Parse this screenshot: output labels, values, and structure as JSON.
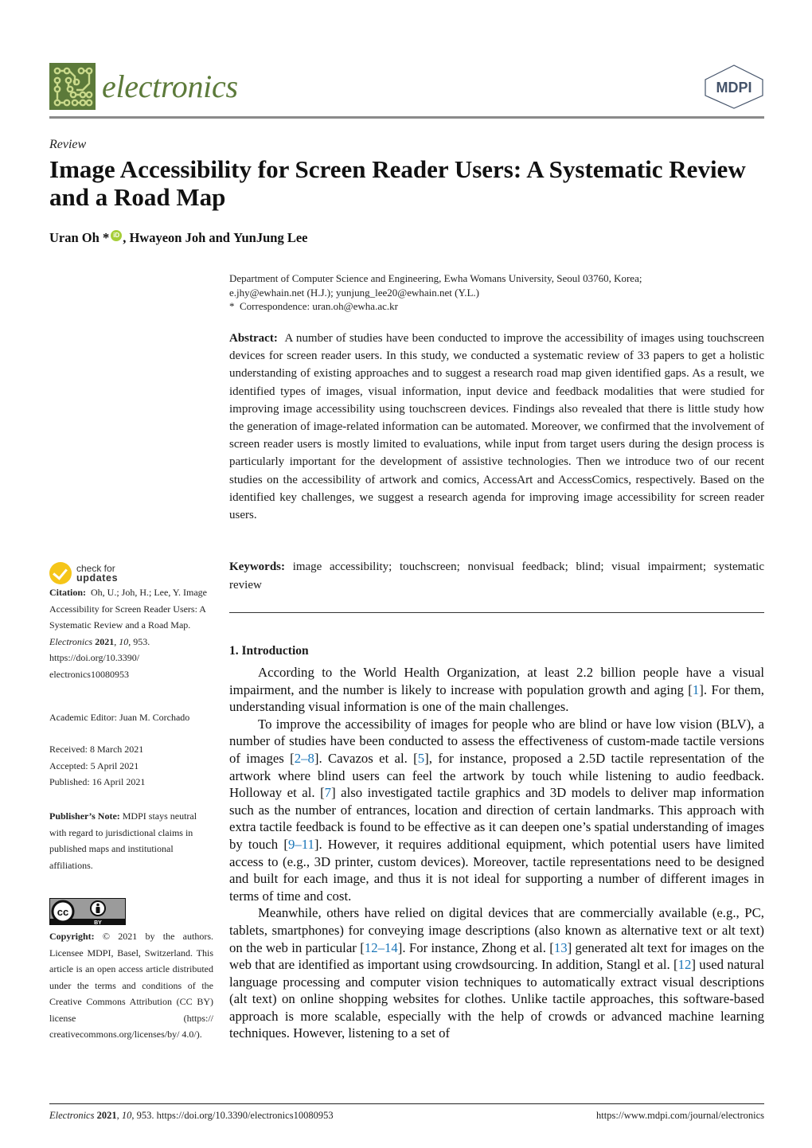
{
  "header": {
    "journal_name": "electronics",
    "journal_logo_icon": "circuit-board-icon",
    "publisher_logo_text": "MDPI",
    "brand_color": "#5c7a3a"
  },
  "article": {
    "type": "Review",
    "title": "Image Accessibility for Screen Reader Users: A Systematic Review and a Road Map",
    "authors": [
      {
        "name": "Uran Oh",
        "mark": "*",
        "orcid": true
      },
      {
        "name": "Hwayeon Joh"
      },
      {
        "name": "YunJung Lee"
      }
    ],
    "author_sep_1": ", ",
    "author_sep_2": " and ",
    "orcid_label": "iD",
    "affiliation_line1": "Department of Computer Science and Engineering, Ewha Womans University, Seoul 03760, Korea;",
    "affiliation_line2": "e.jhy@ewhain.net (H.J.); yunjung_lee20@ewhain.net (Y.L.)",
    "correspondence_mark": "*",
    "correspondence": "Correspondence: uran.oh@ewha.ac.kr",
    "abstract_label": "Abstract:",
    "abstract": "A number of studies have been conducted to improve the accessibility of images using touchscreen devices for screen reader users. In this study, we conducted a systematic review of 33 papers to get a holistic understanding of existing approaches and to suggest a research road map given identified gaps. As a result, we identified types of images, visual information, input device and feedback modalities that were studied for improving image accessibility using touchscreen devices. Findings also revealed that there is little study how the generation of image-related information can be automated. Moreover, we confirmed that the involvement of screen reader users is mostly limited to evaluations, while input from target users during the design process is particularly important for the development of assistive technologies. Then we introduce two of our recent studies on the accessibility of artwork and comics, AccessArt and AccessComics, respectively. Based on the identified key challenges, we suggest a research agenda for improving image accessibility for screen reader users.",
    "keywords_label": "Keywords:",
    "keywords": "image accessibility; touchscreen; nonvisual feedback; blind; visual impairment; systematic review"
  },
  "section": {
    "heading": "1. Introduction",
    "paragraphs": [
      [
        {
          "t": "According to the World Health Organization, at least 2.2 billion people have a visual impairment, and the number is likely to increase with population growth and aging ["
        },
        {
          "ref": "1"
        },
        {
          "t": "]. For them, understanding visual information is one of the main challenges."
        }
      ],
      [
        {
          "t": "To improve the accessibility of images for people who are blind or have low vision (BLV), a number of studies have been conducted to assess the effectiveness of custom-made tactile versions of images ["
        },
        {
          "ref": "2–8"
        },
        {
          "t": "]. Cavazos et al. ["
        },
        {
          "ref": "5"
        },
        {
          "t": "], for instance, proposed a 2.5D tactile representation of the artwork where blind users can feel the artwork by touch while listening to audio feedback. Holloway et al. ["
        },
        {
          "ref": "7"
        },
        {
          "t": "] also investigated tactile graphics and 3D models to deliver map information such as the number of entrances, location and direction of certain landmarks. This approach with extra tactile feedback is found to be effective as it can deepen one’s spatial understanding of images by touch ["
        },
        {
          "ref": "9–11"
        },
        {
          "t": "]. However, it requires additional equipment, which potential users have limited access to (e.g., 3D printer, custom devices). Moreover, tactile representations need to be designed and built for each image, and thus it is not ideal for supporting a number of different images in terms of time and cost."
        }
      ],
      [
        {
          "t": "Meanwhile, others have relied on digital devices that are commercially available (e.g., PC, tablets, smartphones) for conveying image descriptions (also known as alternative text or alt text) on the web in particular ["
        },
        {
          "ref": "12–14"
        },
        {
          "t": "]. For instance, Zhong et al. ["
        },
        {
          "ref": "13"
        },
        {
          "t": "] generated alt text for images on the web that are identified as important using crowdsourcing. In addition, Stangl et al. ["
        },
        {
          "ref": "12"
        },
        {
          "t": "] used natural language processing and computer vision techniques to automatically extract visual descriptions (alt text) on online shopping websites for clothes. Unlike tactile approaches, this software-based approach is more scalable, especially with the help of crowds or advanced machine learning techniques. However, listening to a set of"
        }
      ]
    ],
    "ref_color": "#1a75b8"
  },
  "sidebar": {
    "check_updates_line1": "check for",
    "check_updates_line2": "updates",
    "citation_label": "Citation:",
    "citation_authors": "Oh, U.; Joh, H.; Lee, Y. Image Accessibility for Screen Reader Users: A Systematic Review and a Road Map.",
    "citation_journal": "Electronics",
    "citation_year": "2021",
    "citation_volume": "10",
    "citation_pages": ", 953.",
    "citation_doi": "https://doi.org/10.3390/ electronics10080953",
    "academic_editor": "Academic Editor: Juan M. Corchado",
    "received": "Received: 8 March 2021",
    "accepted": "Accepted: 5 April 2021",
    "published": "Published: 16 April 2021",
    "publisher_note_label": "Publisher’s Note:",
    "publisher_note": "MDPI stays neutral with regard to jurisdictional claims in published maps and institutional affiliations.",
    "cc_label": "cc",
    "cc_by_label": "BY",
    "copyright_label": "Copyright:",
    "copyright": "© 2021 by the authors. Licensee MDPI, Basel, Switzerland. This article is an open access article distributed under the terms and conditions of the Creative Commons Attribution (CC BY) license (https:// creativecommons.org/licenses/by/ 4.0/)."
  },
  "footer": {
    "journal": "Electronics",
    "year": "2021",
    "volume": "10",
    "rest": ", 953. https://doi.org/10.3390/electronics10080953",
    "url": "https://www.mdpi.com/journal/electronics"
  }
}
